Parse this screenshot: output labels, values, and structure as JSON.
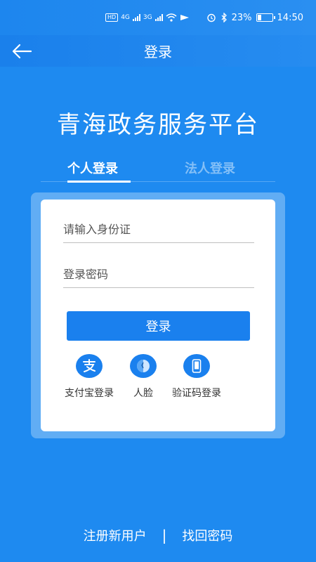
{
  "status_bar": {
    "hd_label": "HD",
    "network1": "4G",
    "network2": "3G",
    "battery": "23%",
    "time": "14:50"
  },
  "header": {
    "title": "登录",
    "back_icon": "arrow-left-icon"
  },
  "main": {
    "platform_title": "青海政务服务平台",
    "tabs": [
      {
        "label": "个人登录",
        "active": true
      },
      {
        "label": "法人登录",
        "active": false
      }
    ]
  },
  "form": {
    "id_placeholder": "请输入身份证",
    "password_placeholder": "登录密码",
    "login_button": "登录"
  },
  "alt_logins": [
    {
      "label": "支付宝登录",
      "icon": "alipay-icon"
    },
    {
      "label": "人脸",
      "icon": "face-icon"
    },
    {
      "label": "验证码登录",
      "icon": "phone-icon"
    }
  ],
  "footer": {
    "register": "注册新用户",
    "separator": "|",
    "recover": "找回密码"
  },
  "colors": {
    "background": "#1e8af0",
    "button": "#1a80ee",
    "card": "#ffffff"
  }
}
